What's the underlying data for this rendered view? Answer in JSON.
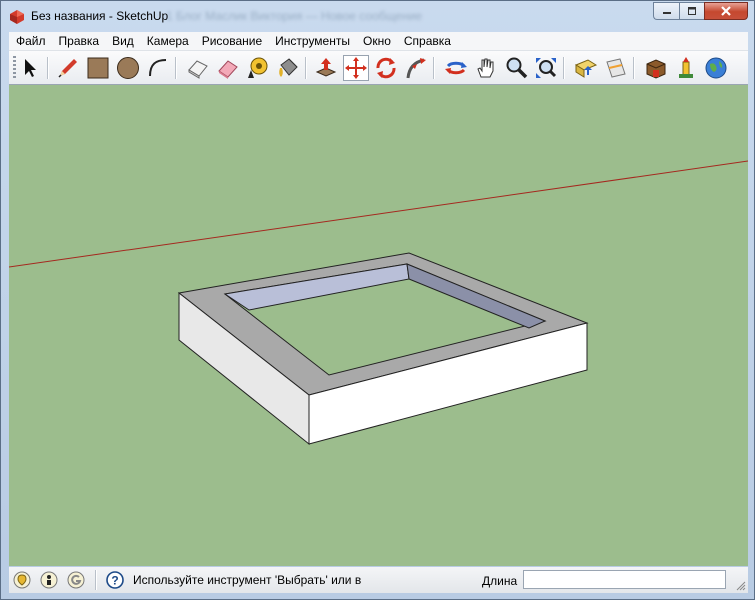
{
  "window": {
    "title": "Без названия - SketchUp",
    "background_ghost_title": "1 Блог Маслик Виктория — Новое сообщение"
  },
  "menu": [
    "Файл",
    "Правка",
    "Вид",
    "Камера",
    "Рисование",
    "Инструменты",
    "Окно",
    "Справка"
  ],
  "toolbar": {
    "tools": [
      {
        "icon": "select-arrow-icon"
      },
      {
        "icon": "pencil-line-icon"
      },
      {
        "icon": "rectangle-icon"
      },
      {
        "icon": "circle-icon"
      },
      {
        "icon": "arc-icon"
      },
      {
        "icon": "eraser-icon"
      },
      {
        "icon": "eraser-pink-icon"
      },
      {
        "icon": "tape-measure-icon"
      },
      {
        "icon": "paint-bucket-icon"
      },
      {
        "icon": "push-pull-icon"
      },
      {
        "icon": "move-icon"
      },
      {
        "icon": "rotate-icon"
      },
      {
        "icon": "follow-me-icon"
      },
      {
        "icon": "orbit-icon"
      },
      {
        "icon": "pan-hand-icon"
      },
      {
        "icon": "zoom-icon"
      },
      {
        "icon": "zoom-extents-icon"
      },
      {
        "icon": "components-icon"
      },
      {
        "icon": "section-plane-icon"
      },
      {
        "icon": "warehouse-icon"
      },
      {
        "icon": "extension-icon"
      },
      {
        "icon": "earth-icon"
      }
    ]
  },
  "colors": {
    "viewport_background": "#9cbd8d",
    "red_axis": "#a5281f",
    "face_top": "#a9a9a9",
    "face_side": "#ffffff",
    "inner_wall": "#b9bfd8"
  },
  "status": {
    "icons": [
      "geolocation-icon",
      "credits-icon",
      "google-sign-in-icon",
      "help-icon"
    ],
    "hint": "Используйте инструмент 'Выбрать' или в",
    "measure_label": "Длина",
    "measure_value": ""
  }
}
